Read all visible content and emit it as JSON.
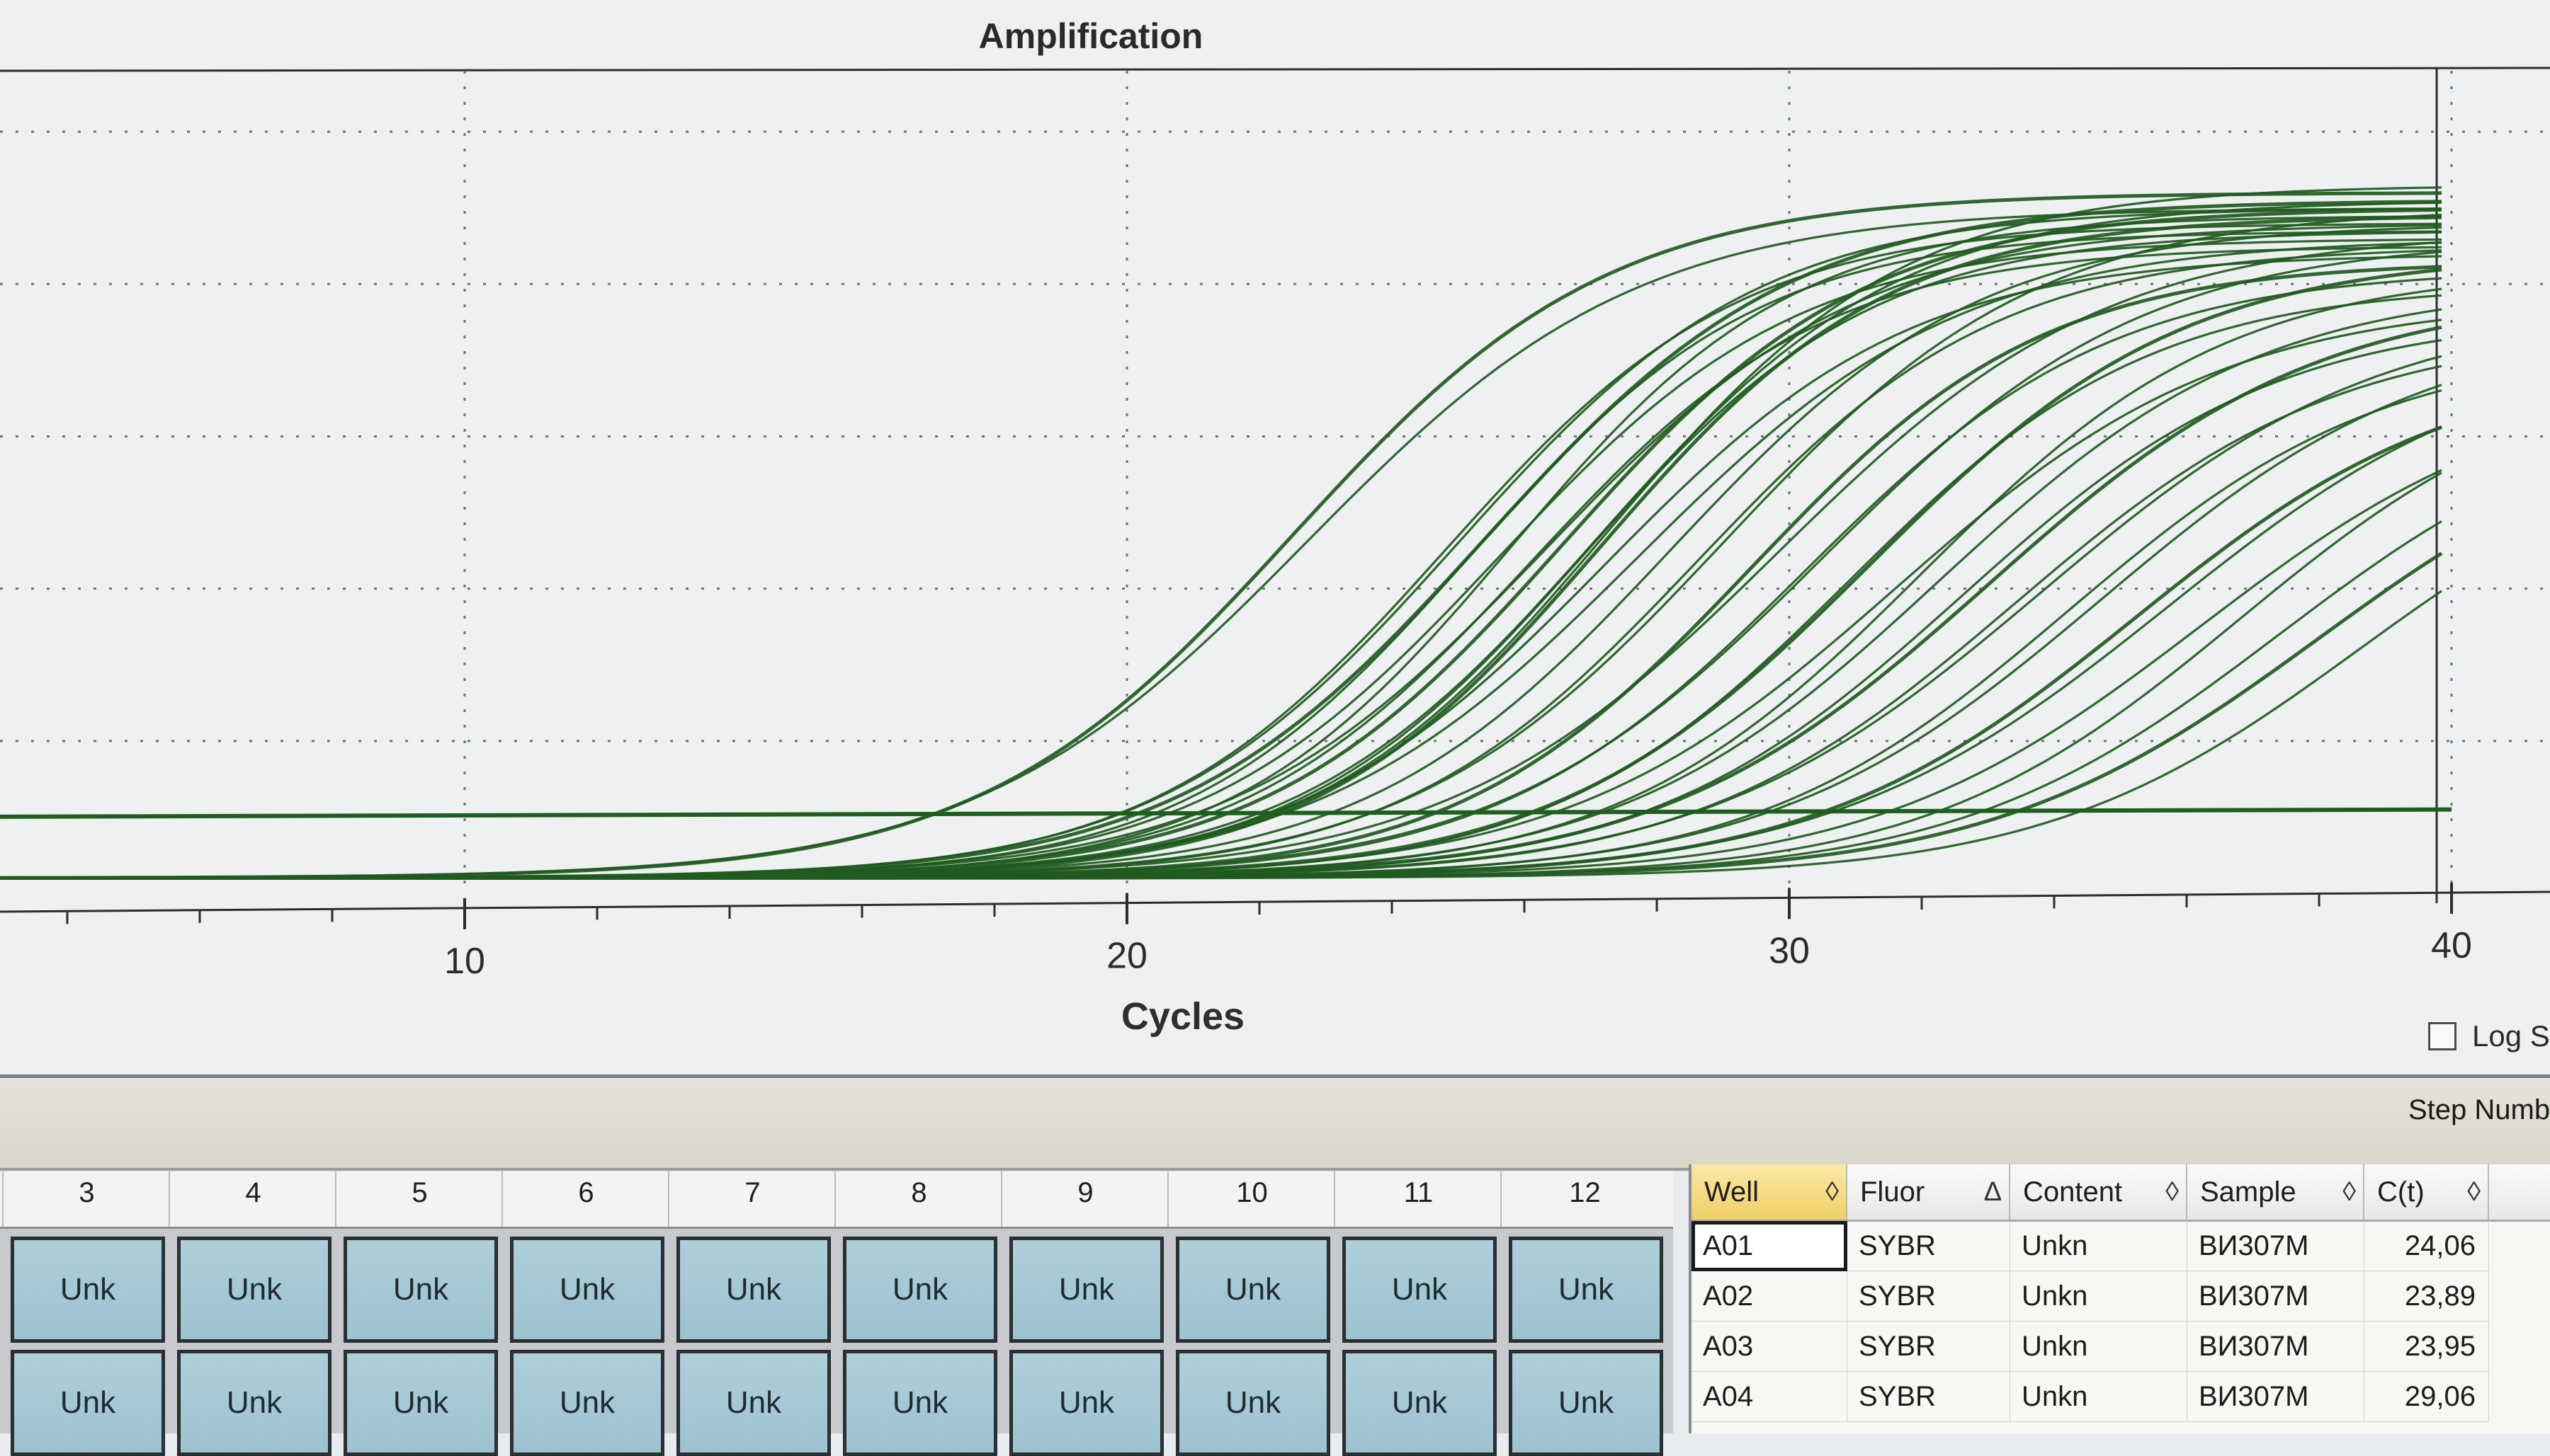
{
  "chart_data": {
    "type": "line",
    "title": "Amplification",
    "xlabel": "Cycles",
    "ylabel": "",
    "xlim": [
      1.1,
      41.7
    ],
    "ylim": [
      0,
      1.08
    ],
    "x_ticks": [
      10,
      20,
      30,
      40
    ],
    "grid": true,
    "threshold_line": {
      "x_start": 1.1,
      "x_end": 40,
      "y_start": 0.1,
      "y_end": 0.11
    },
    "baseline": 0.02,
    "series": [
      {
        "ct": 19.3,
        "plateau": 0.92,
        "k": 0.42
      },
      {
        "ct": 19.5,
        "plateau": 0.9,
        "k": 0.4
      },
      {
        "ct": 21.6,
        "plateau": 0.88,
        "k": 0.45
      },
      {
        "ct": 21.8,
        "plateau": 0.9,
        "k": 0.44
      },
      {
        "ct": 22.0,
        "plateau": 0.87,
        "k": 0.46
      },
      {
        "ct": 22.2,
        "plateau": 0.91,
        "k": 0.43
      },
      {
        "ct": 22.4,
        "plateau": 0.86,
        "k": 0.44
      },
      {
        "ct": 22.6,
        "plateau": 0.89,
        "k": 0.47
      },
      {
        "ct": 22.9,
        "plateau": 0.85,
        "k": 0.45
      },
      {
        "ct": 23.1,
        "plateau": 0.88,
        "k": 0.42
      },
      {
        "ct": 23.4,
        "plateau": 0.9,
        "k": 0.44
      },
      {
        "ct": 23.7,
        "plateau": 0.87,
        "k": 0.46
      },
      {
        "ct": 24.0,
        "plateau": 0.84,
        "k": 0.43
      },
      {
        "ct": 24.06,
        "plateau": 0.93,
        "k": 0.45
      },
      {
        "ct": 23.89,
        "plateau": 0.91,
        "k": 0.44
      },
      {
        "ct": 23.95,
        "plateau": 0.89,
        "k": 0.46
      },
      {
        "ct": 24.5,
        "plateau": 0.86,
        "k": 0.41
      },
      {
        "ct": 25.0,
        "plateau": 0.88,
        "k": 0.43
      },
      {
        "ct": 25.4,
        "plateau": 0.85,
        "k": 0.44
      },
      {
        "ct": 25.8,
        "plateau": 0.9,
        "k": 0.42
      },
      {
        "ct": 26.2,
        "plateau": 0.83,
        "k": 0.45
      },
      {
        "ct": 26.6,
        "plateau": 0.87,
        "k": 0.4
      },
      {
        "ct": 27.0,
        "plateau": 0.82,
        "k": 0.43
      },
      {
        "ct": 27.3,
        "plateau": 0.86,
        "k": 0.41
      },
      {
        "ct": 27.7,
        "plateau": 0.8,
        "k": 0.44
      },
      {
        "ct": 28.0,
        "plateau": 0.84,
        "k": 0.42
      },
      {
        "ct": 28.4,
        "plateau": 0.78,
        "k": 0.4
      },
      {
        "ct": 28.8,
        "plateau": 0.82,
        "k": 0.43
      },
      {
        "ct": 29.06,
        "plateau": 0.8,
        "k": 0.41
      },
      {
        "ct": 29.4,
        "plateau": 0.76,
        "k": 0.42
      },
      {
        "ct": 29.8,
        "plateau": 0.79,
        "k": 0.4
      },
      {
        "ct": 30.2,
        "plateau": 0.74,
        "k": 0.41
      },
      {
        "ct": 30.6,
        "plateau": 0.77,
        "k": 0.39
      },
      {
        "ct": 31.0,
        "plateau": 0.72,
        "k": 0.42
      },
      {
        "ct": 31.5,
        "plateau": 0.75,
        "k": 0.4
      },
      {
        "ct": 32.0,
        "plateau": 0.7,
        "k": 0.41
      },
      {
        "ct": 32.5,
        "plateau": 0.73,
        "k": 0.39
      },
      {
        "ct": 33.0,
        "plateau": 0.68,
        "k": 0.4
      },
      {
        "ct": 33.6,
        "plateau": 0.7,
        "k": 0.42
      },
      {
        "ct": 34.2,
        "plateau": 0.66,
        "k": 0.41
      },
      {
        "ct": 34.8,
        "plateau": 0.65,
        "k": 0.4
      },
      {
        "ct": 35.4,
        "plateau": 0.62,
        "k": 0.42
      }
    ]
  },
  "colors": {
    "curve": "#1f5a1f",
    "threshold": "#1e5e1e",
    "grid": "#6f7275",
    "well_fill": "#a6cad5",
    "sorted_header": "#f1cf63"
  },
  "log_scale": {
    "label": "Log S",
    "checked": false
  },
  "step_bar": {
    "label": "Step Numbe"
  },
  "plate": {
    "columns": [
      "3",
      "4",
      "5",
      "6",
      "7",
      "8",
      "9",
      "10",
      "11",
      "12"
    ],
    "rows": [
      [
        "Unk",
        "Unk",
        "Unk",
        "Unk",
        "Unk",
        "Unk",
        "Unk",
        "Unk",
        "Unk",
        "Unk"
      ],
      [
        "Unk",
        "Unk",
        "Unk",
        "Unk",
        "Unk",
        "Unk",
        "Unk",
        "Unk",
        "Unk",
        "Unk"
      ]
    ]
  },
  "table": {
    "headers": [
      {
        "label": "Well",
        "sort_icon": "◊",
        "sorted": true
      },
      {
        "label": "Fluor",
        "sort_icon": "Δ",
        "sorted": false
      },
      {
        "label": "Content",
        "sort_icon": "◊",
        "sorted": false
      },
      {
        "label": "Sample",
        "sort_icon": "◊",
        "sorted": false
      },
      {
        "label": "C(t)",
        "sort_icon": "◊",
        "sorted": false
      }
    ],
    "rows": [
      [
        "A01",
        "SYBR",
        "Unkn",
        "BИ307M",
        "24,06"
      ],
      [
        "A02",
        "SYBR",
        "Unkn",
        "BИ307M",
        "23,89"
      ],
      [
        "A03",
        "SYBR",
        "Unkn",
        "BИ307M",
        "23,95"
      ],
      [
        "A04",
        "SYBR",
        "Unkn",
        "BИ307M",
        "29,06"
      ]
    ]
  }
}
